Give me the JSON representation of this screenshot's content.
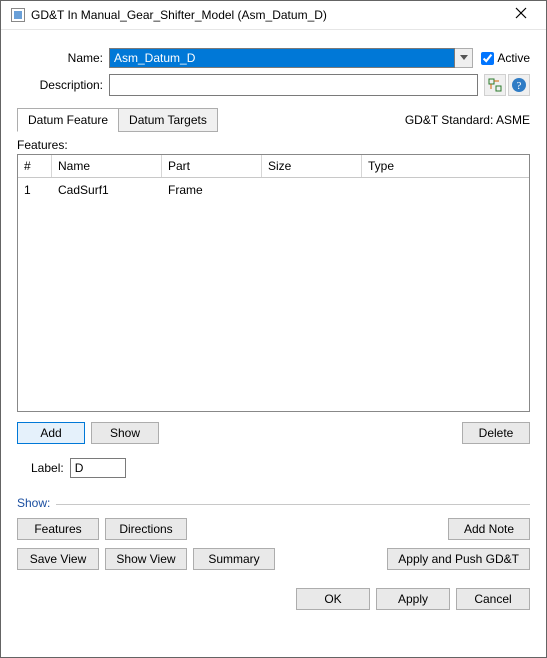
{
  "title": "GD&T In Manual_Gear_Shifter_Model (Asm_Datum_D)",
  "labels": {
    "name": "Name:",
    "description": "Description:",
    "active": "Active",
    "features_section": "Features:",
    "label_field": "Label:",
    "show_section": "Show:",
    "gdtstd": "GD&T Standard: ASME"
  },
  "fields": {
    "name": "Asm_Datum_D",
    "description": "",
    "label": "D"
  },
  "tabs": [
    {
      "label": "Datum Feature",
      "active": true
    },
    {
      "label": "Datum Targets",
      "active": false
    }
  ],
  "grid": {
    "headers": {
      "num": "#",
      "name": "Name",
      "part": "Part",
      "size": "Size",
      "type": "Type"
    },
    "rows": [
      {
        "num": "1",
        "name": "CadSurf1",
        "part": "Frame",
        "size": "",
        "type": ""
      }
    ]
  },
  "buttons": {
    "add": "Add",
    "show": "Show",
    "delete": "Delete",
    "features": "Features",
    "directions": "Directions",
    "addnote": "Add Note",
    "saveview": "Save View",
    "showview": "Show View",
    "summary": "Summary",
    "apply_push": "Apply and Push GD&T",
    "ok": "OK",
    "apply": "Apply",
    "cancel": "Cancel"
  }
}
